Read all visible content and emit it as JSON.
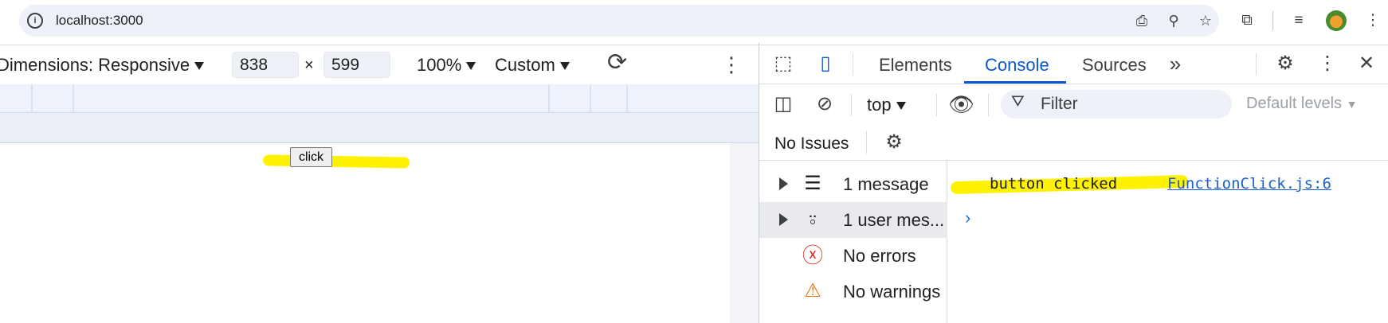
{
  "browser": {
    "url": "localhost:3000"
  },
  "emulation": {
    "dimensions_label": "Dimensions: Responsive",
    "width_value": "838",
    "times": "×",
    "height_value": "599",
    "zoom": "100%",
    "throttle": "Custom"
  },
  "page": {
    "button_label": "click"
  },
  "devtools": {
    "tabs": [
      "Elements",
      "Console",
      "Sources"
    ],
    "active_tab": "Console",
    "console": {
      "context": "top",
      "filter_placeholder": "Filter",
      "levels": "Default levels",
      "issues": "No Issues"
    },
    "sidebar": [
      {
        "label": "1 message",
        "icon": "list-icon",
        "expandable": true
      },
      {
        "label": "1 user mes...",
        "icon": "user-icon",
        "expandable": true,
        "selected": true
      },
      {
        "label": "No errors",
        "icon": "error-icon",
        "expandable": false
      },
      {
        "label": "No warnings",
        "icon": "warning-icon",
        "expandable": false
      }
    ],
    "log": {
      "message": "button clicked",
      "source": "FunctionClick.js:6"
    }
  },
  "colors": {
    "accent": "#0b57d0",
    "highlight": "#fff200",
    "error": "#d93025",
    "warning": "#e8710a"
  }
}
